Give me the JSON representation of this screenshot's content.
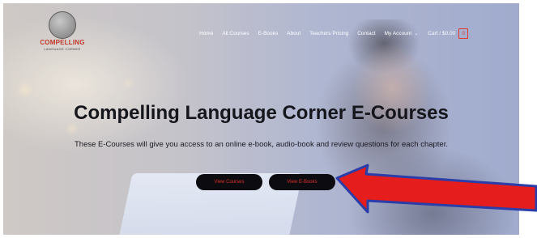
{
  "site": {
    "logo_text": "COMPELLING",
    "logo_sub": "LANGUAGE CORNER"
  },
  "nav": {
    "items": [
      "Home",
      "All Courses",
      "E-Books",
      "About",
      "Teachers Pricing",
      "Contact",
      "My Account"
    ],
    "cart_label": "Cart / $0.00",
    "cart_count": "0"
  },
  "hero": {
    "title": "Compelling Language Corner E-Courses",
    "subtitle": "These E-Courses will give you access to an online e-book, audio-book and review questions for each chapter.",
    "buttons": {
      "courses": "View Courses",
      "ebooks": "View E-Books"
    }
  },
  "colors": {
    "accent_red": "#e43a2b",
    "arrow_red": "#e51d1d",
    "arrow_outline": "#2a3da8"
  }
}
